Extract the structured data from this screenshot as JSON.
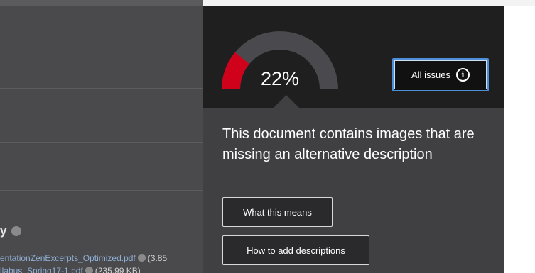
{
  "background_page": {
    "heading_fragment": "y",
    "files": [
      {
        "name": "entationZenExcerpts_Optimized.pdf",
        "size": "(3.85"
      },
      {
        "name": "llabus_Spring17-1.pdf",
        "size": "(235.99 KB)"
      }
    ]
  },
  "accessibility_panel": {
    "score_label": "22%",
    "score_fraction": 0.22,
    "colors": {
      "gauge_fill": "#d0021b",
      "gauge_track": "#4a4a4e",
      "panel_top": "#1f1f1f",
      "panel_body": "#404043",
      "focus_ring": "#4f8fd8"
    },
    "all_issues_label": "All issues",
    "all_issues_icon": "info-icon",
    "message": "This document contains images that are missing an alternative description",
    "what_this_means_label": "What this means",
    "how_to_add_label": "How to add descriptions"
  }
}
